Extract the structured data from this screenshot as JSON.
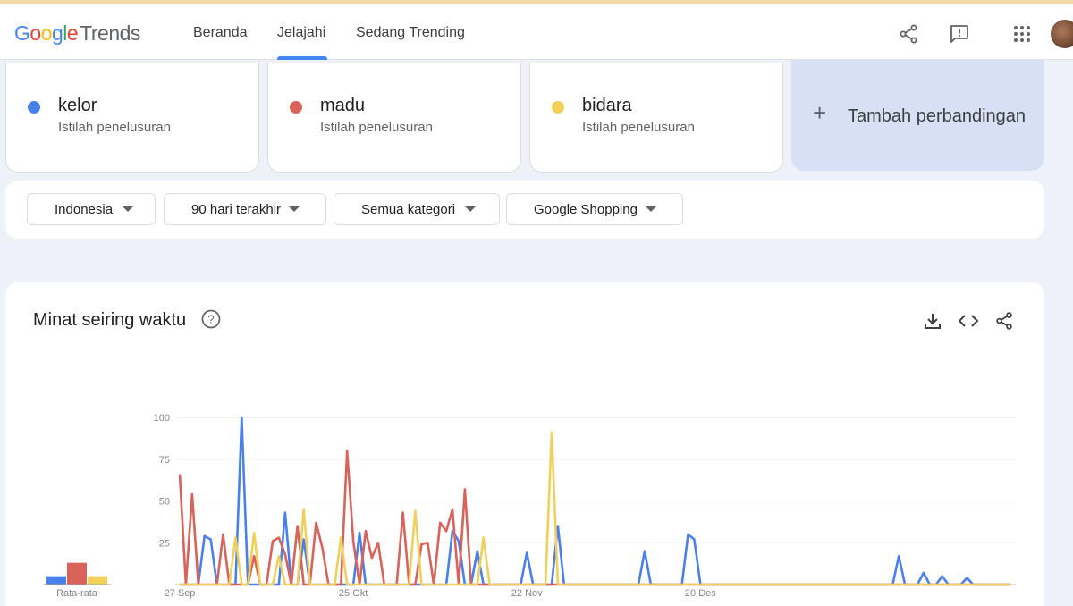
{
  "header": {
    "logo_google": "Google",
    "logo_trends": "Trends",
    "nav": [
      "Beranda",
      "Jelajahi",
      "Sedang Trending"
    ],
    "active_nav": "Jelajahi",
    "icons": [
      "share-icon",
      "feedback-icon",
      "apps-grid-icon",
      "avatar"
    ]
  },
  "terms": [
    {
      "name": "kelor",
      "type": "Istilah penelusuran",
      "color": "#4a80ec"
    },
    {
      "name": "madu",
      "type": "Istilah penelusuran",
      "color": "#d9625a"
    },
    {
      "name": "bidara",
      "type": "Istilah penelusuran",
      "color": "#f0d05a"
    }
  ],
  "add_compare": {
    "icon": "+",
    "label": "Tambah perbandingan"
  },
  "filters": [
    "Indonesia",
    "90 hari terakhir",
    "Semua kategori",
    "Google Shopping"
  ],
  "chart_card": {
    "title": "Minat seiring waktu",
    "icons": [
      "help-icon",
      "download-icon",
      "embed-icon",
      "share-icon"
    ],
    "avg_label": "Rata-rata"
  },
  "chart_data": {
    "type": "line",
    "ylim": [
      0,
      100
    ],
    "yticks": [
      25,
      50,
      75,
      100
    ],
    "xtick_labels": [
      {
        "index": 0,
        "label": "27 Sep"
      },
      {
        "index": 28,
        "label": "25 Okt"
      },
      {
        "index": 56,
        "label": "22 Nov"
      },
      {
        "index": 84,
        "label": "20 Des"
      }
    ],
    "grid": true,
    "averages": [
      {
        "name": "kelor",
        "value": 5
      },
      {
        "name": "madu",
        "value": 13
      },
      {
        "name": "bidara",
        "value": 5
      }
    ],
    "series": [
      {
        "name": "kelor",
        "color": "#4a80ec",
        "values": [
          0,
          0,
          0,
          0,
          29,
          27,
          0,
          0,
          0,
          0,
          100,
          0,
          0,
          0,
          0,
          0,
          0,
          43,
          0,
          0,
          27,
          0,
          0,
          0,
          0,
          0,
          0,
          0,
          0,
          31,
          0,
          0,
          0,
          0,
          0,
          0,
          0,
          0,
          0,
          0,
          0,
          0,
          0,
          0,
          32,
          26,
          0,
          0,
          20,
          0,
          0,
          0,
          0,
          0,
          0,
          0,
          19,
          0,
          0,
          0,
          0,
          35,
          0,
          0,
          0,
          0,
          0,
          0,
          0,
          0,
          0,
          0,
          0,
          0,
          0,
          20,
          0,
          0,
          0,
          0,
          0,
          0,
          30,
          27,
          0,
          0,
          0,
          0,
          0,
          0,
          0,
          0,
          0,
          0,
          0,
          0,
          0,
          0,
          0,
          0,
          0,
          0,
          0,
          0,
          0,
          0,
          0,
          0,
          0,
          0,
          0,
          0,
          0,
          0,
          0,
          0,
          17,
          0,
          0,
          0,
          7,
          0,
          0,
          5,
          0,
          0,
          0,
          4,
          0,
          0,
          0,
          0,
          0,
          0,
          0
        ]
      },
      {
        "name": "madu",
        "color": "#d9625a",
        "values": [
          66,
          0,
          54,
          0,
          0,
          0,
          0,
          30,
          0,
          0,
          0,
          0,
          17,
          0,
          0,
          26,
          28,
          18,
          0,
          35,
          0,
          0,
          37,
          22,
          0,
          0,
          0,
          80,
          26,
          0,
          32,
          16,
          25,
          0,
          0,
          0,
          43,
          0,
          0,
          24,
          25,
          0,
          37,
          32,
          45,
          0,
          57,
          0,
          0,
          0,
          0,
          0,
          0,
          0,
          0,
          0,
          0,
          0,
          0,
          0,
          0,
          0,
          0,
          0,
          0,
          0,
          0,
          0,
          0,
          0,
          0,
          0,
          0,
          0,
          0,
          0,
          0,
          0,
          0,
          0,
          0,
          0,
          0,
          0,
          0,
          0,
          0,
          0,
          0,
          0,
          0,
          0,
          0,
          0,
          0,
          0,
          0,
          0,
          0,
          0,
          0,
          0,
          0,
          0,
          0,
          0,
          0,
          0,
          0,
          0,
          0,
          0,
          0,
          0,
          0,
          0,
          0,
          0,
          0,
          0,
          0,
          0,
          0,
          0,
          0,
          0,
          0,
          0,
          0,
          0,
          0,
          0,
          0,
          0,
          0
        ]
      },
      {
        "name": "bidara",
        "color": "#f0d05a",
        "values": [
          0,
          0,
          0,
          0,
          0,
          0,
          0,
          0,
          0,
          28,
          0,
          0,
          31,
          0,
          0,
          0,
          17,
          0,
          0,
          0,
          45,
          0,
          0,
          0,
          0,
          0,
          28,
          0,
          0,
          0,
          0,
          0,
          0,
          0,
          0,
          0,
          0,
          0,
          44,
          0,
          0,
          0,
          0,
          0,
          0,
          0,
          0,
          0,
          0,
          28,
          0,
          0,
          0,
          0,
          0,
          0,
          0,
          0,
          0,
          0,
          91,
          0,
          0,
          0,
          0,
          0,
          0,
          0,
          0,
          0,
          0,
          0,
          0,
          0,
          0,
          0,
          0,
          0,
          0,
          0,
          0,
          0,
          0,
          0,
          0,
          0,
          0,
          0,
          0,
          0,
          0,
          0,
          0,
          0,
          0,
          0,
          0,
          0,
          0,
          0,
          0,
          0,
          0,
          0,
          0,
          0,
          0,
          0,
          0,
          0,
          0,
          0,
          0,
          0,
          0,
          0,
          0,
          0,
          0,
          0,
          0,
          0,
          0,
          0,
          0,
          0,
          0,
          0,
          0,
          0,
          0,
          0,
          0,
          0,
          0
        ]
      }
    ]
  }
}
